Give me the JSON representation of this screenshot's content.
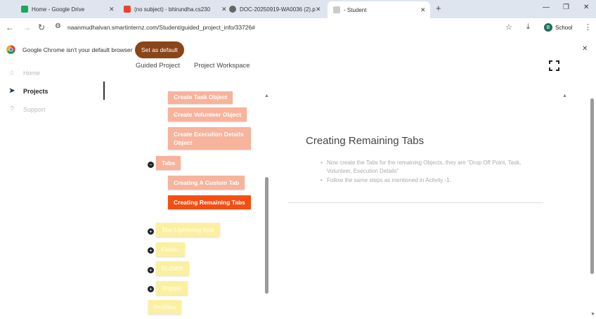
{
  "browser": {
    "tabs": [
      {
        "title": "Home - Google Drive",
        "active": false,
        "favicon_color": "#1fa463"
      },
      {
        "title": "(no subject) - bhirundha.cs230",
        "active": false,
        "favicon_color": "#ea4335"
      },
      {
        "title": "DOC-20250919-WA0036 (2).p",
        "active": false,
        "favicon_color": "#666666"
      },
      {
        "title": "- Student",
        "active": true,
        "favicon_color": "#999999"
      }
    ],
    "new_tab": "+",
    "url": "naanmudhalvan.smartinternz.com/Student/guided_project_info/33726#",
    "profile_initial": "B",
    "profile_label": "School"
  },
  "infobar": {
    "message": "Google Chrome isn't your default browser",
    "button": "Set as default"
  },
  "sidebar": {
    "items": [
      {
        "label": "Home",
        "icon": "home-icon",
        "active": false
      },
      {
        "label": "Projects",
        "icon": "paper-plane-icon",
        "active": true
      },
      {
        "label": "Support",
        "icon": "question-icon",
        "active": false
      }
    ]
  },
  "top_tabs": [
    "Guided Project",
    "Project Workspace"
  ],
  "tree": {
    "objects": [
      "Create Task Object",
      "Create Volunteer Object",
      "Create Execution Details Object"
    ],
    "tabs_section": "Tabs",
    "tabs_items": [
      "Creating A Custom Tab",
      "Creating Remaining Tabs"
    ],
    "more_sections": [
      "The Lightning App",
      "Fields",
      "FLOWS",
      "Trigger",
      "Profiles"
    ]
  },
  "content": {
    "title": "Creating Remaining Tabs",
    "bullets": [
      "Now create the Tabs for the remaining Objects, they are \"Drop Off Point, Task, Volunteer, Execution Details\"",
      "Follow the same steps as mentioned in Activity -1."
    ]
  }
}
